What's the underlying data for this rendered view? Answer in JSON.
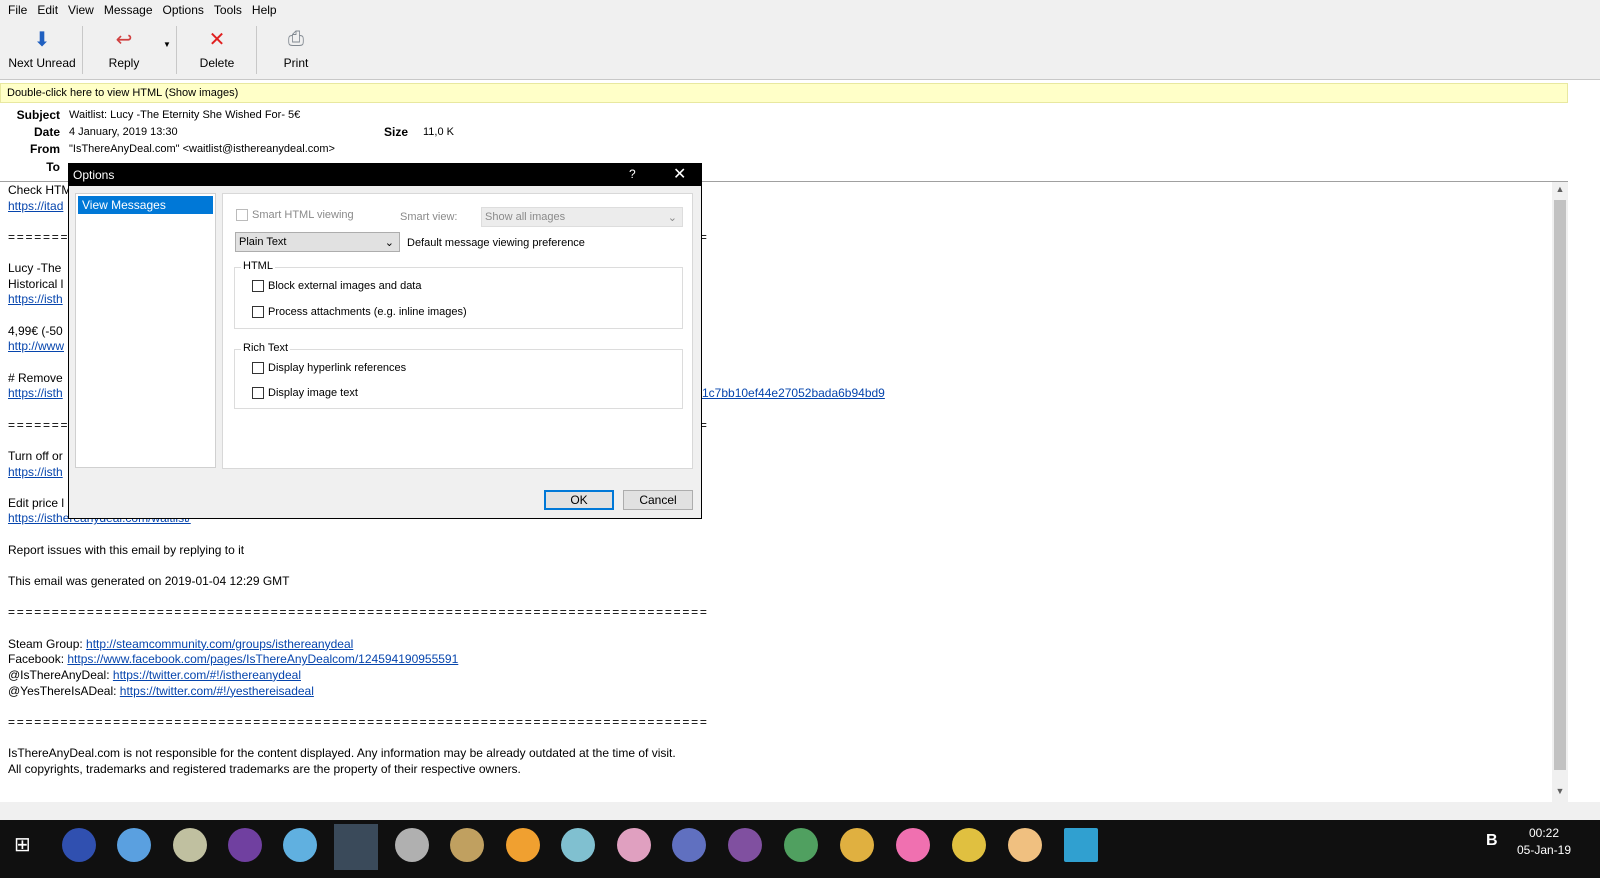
{
  "menu": [
    "File",
    "Edit",
    "View",
    "Message",
    "Options",
    "Tools",
    "Help"
  ],
  "toolbar": {
    "next_unread": "Next Unread",
    "reply": "Reply",
    "delete": "Delete",
    "print": "Print"
  },
  "infobar": "Double-click here to view HTML (Show images)",
  "header": {
    "subject_label": "Subject",
    "subject": "Waitlist: Lucy -The Eternity She Wished For- 5€",
    "date_label": "Date",
    "date": "4 January, 2019 13:30",
    "size_label": "Size",
    "size": "11,0 K",
    "from_label": "From",
    "from": "\"IsThereAnyDeal.com\" <waitlist@isthereanydeal.com>",
    "to_label": "To"
  },
  "body": {
    "l1": "Check HTM",
    "l2": "https://itad",
    "eq": "================================================================================",
    "l4": "Lucy -The",
    "l5": "Historical l",
    "l6": "https://isth",
    "l8": "4,99€ (-50",
    "l9": "http://www",
    "l11": "# Remove",
    "l12": "https://isth",
    "l12b": "1c7bb10ef44e27052bada6b94bd9",
    "l15": "Turn off or",
    "l16": "https://isth",
    "l18": "Edit price l",
    "l19": "https://isthereanydeal.com/waitlist/",
    "l21": "Report issues with this email by replying to it",
    "l23": "This email was generated on 2019-01-04 12:29 GMT",
    "steam_label": "Steam Group: ",
    "steam": "http://steamcommunity.com/groups/isthereanydeal",
    "fb_label": "Facebook: ",
    "fb": "https://www.facebook.com/pages/IsThereAnyDealcom/124594190955591",
    "tw1_label": "@IsThereAnyDeal: ",
    "tw1": "https://twitter.com/#!/isthereanydeal",
    "tw2_label": "@YesThereIsADeal: ",
    "tw2": "https://twitter.com/#!/yesthereisadeal",
    "disc1": "IsThereAnyDeal.com is not responsible for the content displayed. Any information may be already outdated at the time of visit.",
    "disc2": "All copyrights, trademarks and registered trademarks are the property of their respective owners."
  },
  "dialog": {
    "title": "Options",
    "help": "?",
    "close": "✕",
    "nav_item": "View Messages",
    "smart_html": "Smart HTML viewing",
    "smart_view_label": "Smart view:",
    "smart_view_value": "Show all images",
    "view_pref": "Plain Text",
    "view_pref_label": "Default message viewing preference",
    "html_group": "HTML",
    "block_ext": "Block external images and data",
    "process_att": "Process attachments (e.g. inline images)",
    "rich_group": "Rich Text",
    "hyperlink_refs": "Display hyperlink references",
    "image_text": "Display image text",
    "ok": "OK",
    "cancel": "Cancel"
  },
  "clock": {
    "time": "00:22",
    "date": "05-Jan-19"
  }
}
